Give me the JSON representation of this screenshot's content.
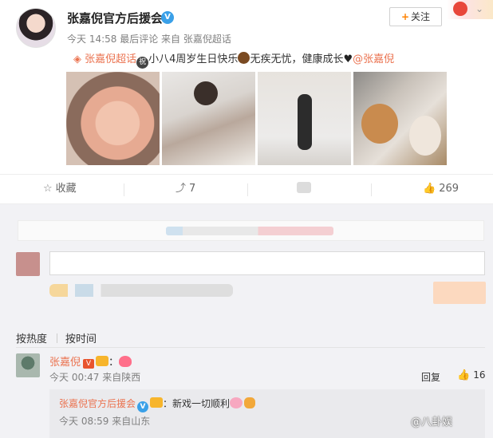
{
  "header": {
    "author": "张嘉倪官方后援会",
    "meta": "今天 14:58 最后评论 来自 张嘉倪超话",
    "follow_label": "关注"
  },
  "post": {
    "text_link": "张嘉倪超话",
    "text_body": "小八4周岁生日快乐",
    "text_body2": "无疾无忧，健康成长",
    "mention": "@张嘉倪",
    "photo_count": 4
  },
  "actions": {
    "collect": "收藏",
    "repost_count": "7",
    "like_count": "269"
  },
  "comments": {
    "sort_hot": "按热度",
    "sort_time": "按时间",
    "items": [
      {
        "user": "张嘉倪",
        "vip": "V",
        "text": "：",
        "time": "今天 00:47 来自陕西",
        "reply_label": "回复",
        "likes": "16",
        "reply": {
          "user": "张嘉倪官方后援会",
          "text": "：新戏一切顺利",
          "time": "今天 08:59 来自山东"
        }
      }
    ]
  },
  "watermark": "@八卦娱",
  "colors": {
    "link": "#eb7350",
    "verified": "#3aa0e8",
    "panel_bg": "#f2f2f5"
  }
}
